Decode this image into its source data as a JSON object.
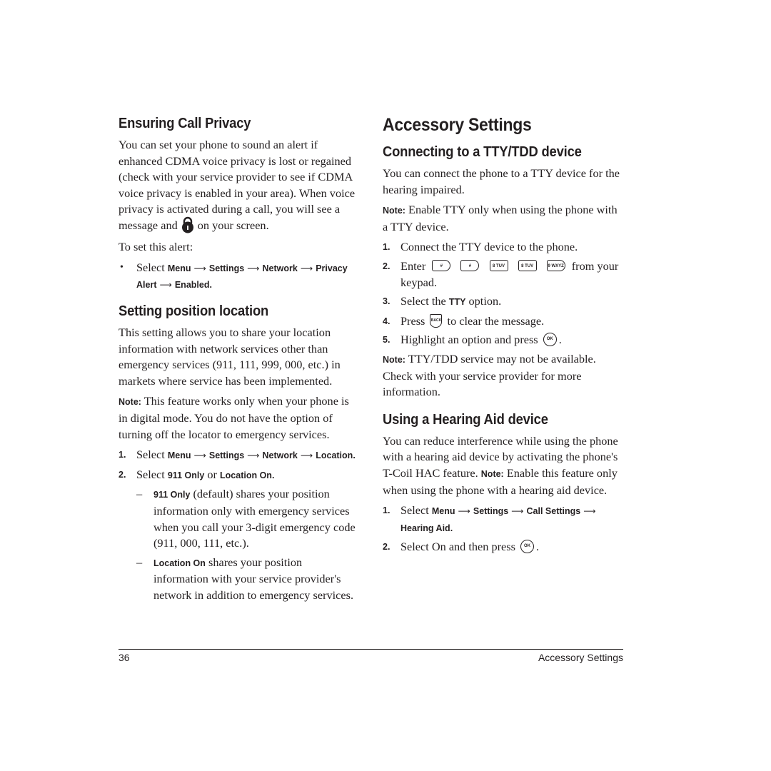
{
  "left": {
    "privacy": {
      "heading": "Ensuring Call Privacy",
      "body_before_icon": "You can set your phone to sound an alert if enhanced CDMA voice privacy is lost or regained (check with your service provider to see if CDMA voice privacy is enabled in your area). When voice privacy is activated during a call, you will see a message and",
      "body_after_icon": "on your screen.",
      "icon": "lock-icon",
      "intro": "To set this alert:",
      "bullet": {
        "select": "Select",
        "path": [
          "Menu",
          "Settings",
          "Network",
          "Privacy Alert",
          "Enabled"
        ],
        "end": "."
      }
    },
    "location": {
      "heading": "Setting position location",
      "body": "This setting allows you to share your location information with network services other than emergency services (911, 111, 999, 000, etc.) in markets where service has been implemented.",
      "note_label": "Note:",
      "note_text": "This feature works only when your phone is in digital mode. You do not have the option of turning off the locator to emergency services.",
      "steps": [
        {
          "num": "1.",
          "select": "Select",
          "path": [
            "Menu",
            "Settings",
            "Network",
            "Location"
          ],
          "end": "."
        },
        {
          "num": "2.",
          "select": "Select",
          "opt1": "911 Only",
          "or": "or",
          "opt2": "Location On",
          "end": "."
        }
      ],
      "subitems": [
        {
          "label": "911 Only",
          "text": "(default) shares your position information only with emergency services when you call your 3-digit emergency code (911, 000, 111, etc.)."
        },
        {
          "label": "Location On",
          "text": "shares your position information with your service provider's network in addition to emergency services."
        }
      ]
    }
  },
  "right": {
    "title": "Accessory Settings",
    "tty": {
      "heading": "Connecting to a TTY/TDD device",
      "body": "You can connect the phone to a TTY device for the hearing impaired.",
      "note_label": "Note:",
      "note_text": "Enable TTY only when using the phone with a TTY device.",
      "steps": [
        {
          "num": "1.",
          "text": "Connect the TTY device to the phone."
        },
        {
          "num": "2.",
          "before": "Enter",
          "keys": [
            "#",
            "#",
            "8 TUV",
            "8 TUV",
            "9 WXYZ"
          ],
          "after": "from your keypad."
        },
        {
          "num": "3.",
          "before": "Select the",
          "bold": "TTY",
          "after": "option."
        },
        {
          "num": "4.",
          "before": "Press",
          "key": "BACK",
          "after": "to clear the message."
        },
        {
          "num": "5.",
          "before": "Highlight an option and press",
          "key": "OK",
          "after": "."
        }
      ],
      "note2_label": "Note:",
      "note2_text": "TTY/TDD service may not be available. Check with your service provider for more information."
    },
    "hearing": {
      "heading": "Using a Hearing Aid device",
      "body": "You can reduce interference while using the phone with a hearing aid device by activating the phone's T-Coil HAC feature.",
      "note_label": "Note:",
      "note_text": "Enable this feature only when using the phone with a hearing aid device.",
      "steps": [
        {
          "num": "1.",
          "select": "Select",
          "path": [
            "Menu",
            "Settings",
            "Call Settings",
            "Hearing Aid"
          ],
          "end": "."
        },
        {
          "num": "2.",
          "before": "Select On and then press",
          "key": "OK",
          "after": "."
        }
      ]
    }
  },
  "footer": {
    "page_number": "36",
    "section_title": "Accessory Settings"
  },
  "arrow": "⟶"
}
